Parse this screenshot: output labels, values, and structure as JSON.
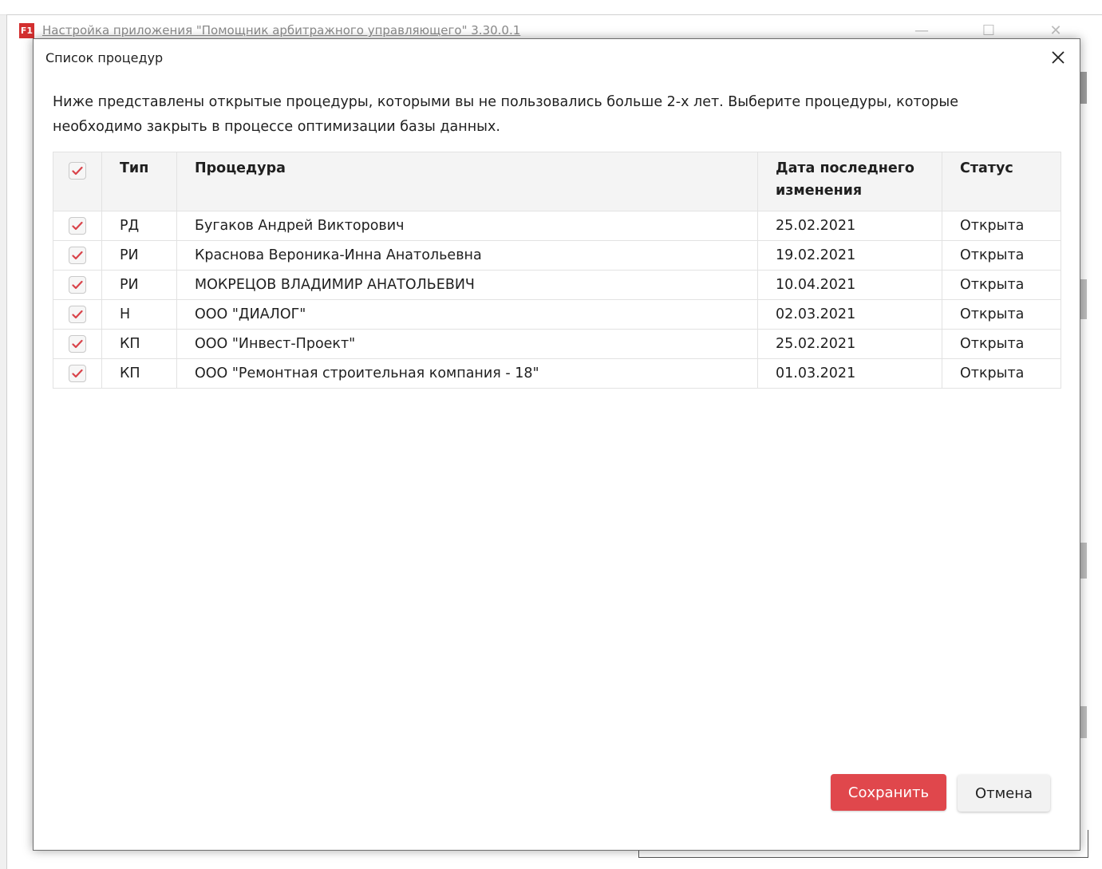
{
  "parent_window": {
    "title": "Настройка приложения \"Помощник арбитражного управляющего\" 3.30.0.1",
    "app_icon_text": "F1"
  },
  "dialog": {
    "title": "Список процедур",
    "intro": "Ниже представлены открытые процедуры, которыми вы не пользовались больше 2-х лет. Выберите процедуры, которые необходимо закрыть в процессе оптимизации базы данных.",
    "table": {
      "select_all_checked": true,
      "headers": {
        "type": "Тип",
        "procedure": "Процедура",
        "date": "Дата последнего изменения",
        "status": "Статус"
      },
      "rows": [
        {
          "checked": true,
          "type": "РД",
          "procedure": "Бугаков Андрей Викторович",
          "date": "25.02.2021",
          "status": "Открыта"
        },
        {
          "checked": true,
          "type": "РИ",
          "procedure": "Краснова Вероника-Инна Анатольевна",
          "date": "19.02.2021",
          "status": "Открыта"
        },
        {
          "checked": true,
          "type": "РИ",
          "procedure": "МОКРЕЦОВ ВЛАДИМИР АНАТОЛЬЕВИЧ",
          "date": "10.04.2021",
          "status": "Открыта"
        },
        {
          "checked": true,
          "type": "Н",
          "procedure": "ООО \"ДИАЛОГ\"",
          "date": "02.03.2021",
          "status": "Открыта"
        },
        {
          "checked": true,
          "type": "КП",
          "procedure": "ООО \"Инвест-Проект\"",
          "date": "25.02.2021",
          "status": "Открыта"
        },
        {
          "checked": true,
          "type": "КП",
          "procedure": "ООО \"Ремонтная строительная компания - 18\"",
          "date": "01.03.2021",
          "status": "Открыта"
        }
      ]
    },
    "buttons": {
      "save": "Сохранить",
      "cancel": "Отмена"
    }
  },
  "colors": {
    "accent": "#e0474c",
    "check": "#d9434a"
  }
}
